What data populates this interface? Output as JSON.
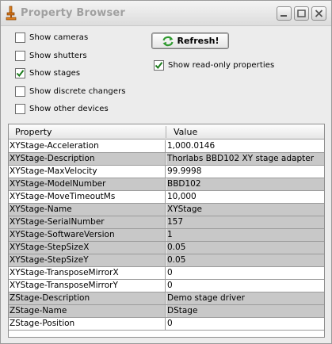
{
  "window": {
    "title": "Property Browser"
  },
  "controls": {
    "refresh_label": "Refresh!",
    "checkboxes": [
      {
        "label": "Show cameras",
        "checked": false
      },
      {
        "label": "Show shutters",
        "checked": false
      },
      {
        "label": "Show stages",
        "checked": true
      },
      {
        "label": "Show discrete changers",
        "checked": false
      },
      {
        "label": "Show other devices",
        "checked": false
      }
    ],
    "readonly": {
      "label": "Show read-only properties",
      "checked": true
    }
  },
  "table": {
    "columns": [
      "Property",
      "Value"
    ],
    "rows": [
      {
        "property": "XYStage-Acceleration",
        "value": "1,000.0146",
        "shaded": false
      },
      {
        "property": "XYStage-Description",
        "value": "Thorlabs BBD102 XY stage adapter",
        "shaded": true
      },
      {
        "property": "XYStage-MaxVelocity",
        "value": "99.9998",
        "shaded": false
      },
      {
        "property": "XYStage-ModelNumber",
        "value": "BBD102",
        "shaded": true
      },
      {
        "property": "XYStage-MoveTimeoutMs",
        "value": "10,000",
        "shaded": false
      },
      {
        "property": "XYStage-Name",
        "value": "XYStage",
        "shaded": true
      },
      {
        "property": "XYStage-SerialNumber",
        "value": "157",
        "shaded": true
      },
      {
        "property": "XYStage-SoftwareVersion",
        "value": "1",
        "shaded": true
      },
      {
        "property": "XYStage-StepSizeX",
        "value": "0.05",
        "shaded": true
      },
      {
        "property": "XYStage-StepSizeY",
        "value": "0.05",
        "shaded": true
      },
      {
        "property": "XYStage-TransposeMirrorX",
        "value": "0",
        "shaded": false
      },
      {
        "property": "XYStage-TransposeMirrorY",
        "value": "0",
        "shaded": false
      },
      {
        "property": "ZStage-Description",
        "value": "Demo stage driver",
        "shaded": true
      },
      {
        "property": "ZStage-Name",
        "value": "DStage",
        "shaded": true
      },
      {
        "property": "ZStage-Position",
        "value": "0",
        "shaded": false
      }
    ]
  },
  "icons": {
    "app": "microscope-icon",
    "refresh": "refresh-arrows-icon",
    "check": "checkmark-icon"
  },
  "colors": {
    "shaded_row": "#c8c8c8",
    "refresh_arrows": "#2f9a2f",
    "check_mark": "#1a7a1a"
  }
}
